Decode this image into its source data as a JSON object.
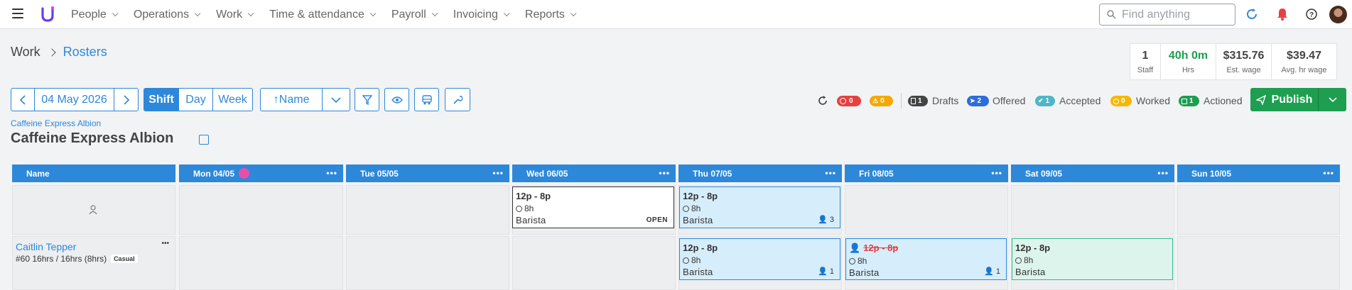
{
  "nav": {
    "menu": [
      "People",
      "Operations",
      "Work",
      "Time & attendance",
      "Payroll",
      "Invoicing",
      "Reports"
    ],
    "search_placeholder": "Find anything"
  },
  "breadcrumb": {
    "parent": "Work",
    "current": "Rosters"
  },
  "summary": [
    {
      "value": "1",
      "label": "Staff",
      "color": "#444444"
    },
    {
      "value": "40h 0m",
      "label": "Hrs",
      "color": "#1e9e50"
    },
    {
      "value": "$315.76",
      "label": "Est. wage",
      "color": "#444444"
    },
    {
      "value": "$39.47",
      "label": "Avg. hr wage",
      "color": "#444444"
    }
  ],
  "toolbar": {
    "date": "04 May 2026",
    "views": [
      "Shift",
      "Day",
      "Week"
    ],
    "sort_label": "↑Name"
  },
  "status": {
    "errors": "0",
    "warnings": "0",
    "drafts": {
      "count": "1",
      "label": "Drafts"
    },
    "offered": {
      "count": "2",
      "label": "Offered"
    },
    "accepted": {
      "count": "1",
      "label": "Accepted"
    },
    "worked": {
      "count": "0",
      "label": "Worked"
    },
    "actioned": {
      "count": "1",
      "label": "Actioned"
    }
  },
  "publish_label": "Publish",
  "location": {
    "link": "Caffeine Express Albion",
    "title": "Caffeine Express Albion"
  },
  "columns": [
    "Name",
    "Mon 04/05",
    "Tue 05/05",
    "Wed 06/05",
    "Thu 07/05",
    "Fri 08/05",
    "Sat 09/05",
    "Sun 10/05"
  ],
  "shifts": {
    "wed_open": {
      "time": "12p - 8p",
      "dur": "8h",
      "role": "Barista",
      "tag": "OPEN"
    },
    "thu_open": {
      "time": "12p - 8p",
      "dur": "8h",
      "role": "Barista",
      "count": "3"
    },
    "thu_staff": {
      "time": "12p - 8p",
      "dur": "8h",
      "role": "Barista",
      "count": "1"
    },
    "fri_staff": {
      "time": "12p - 8p",
      "dur": "8h",
      "role": "Barista",
      "count": "1"
    },
    "sat_staff": {
      "time": "12p - 8p",
      "dur": "8h",
      "role": "Barista"
    }
  },
  "staff": {
    "name": "Caitlin Tepper",
    "meta": "#60 16hrs / 16hrs (8hrs)",
    "type": "Casual"
  },
  "colors": {
    "accent": "#2d88d9",
    "publish": "#1e9e50",
    "error": "#e84040",
    "warning": "#f5a800"
  }
}
